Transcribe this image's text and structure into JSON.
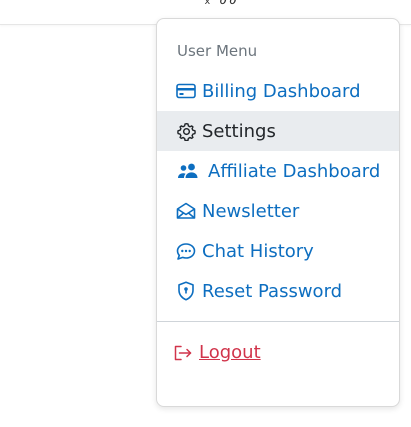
{
  "topbar": {
    "glyph": "ₓ ∂∂"
  },
  "menu": {
    "header": "User Menu",
    "items": [
      {
        "label": "Billing Dashboard",
        "icon": "credit-card-icon"
      },
      {
        "label": "Settings",
        "icon": "gear-icon",
        "active": true
      },
      {
        "label": "Affiliate Dashboard",
        "icon": "people-icon"
      },
      {
        "label": "Newsletter",
        "icon": "envelope-icon"
      },
      {
        "label": "Chat History",
        "icon": "chat-dots-icon"
      },
      {
        "label": "Reset Password",
        "icon": "shield-lock-icon"
      }
    ],
    "logout": {
      "label": "Logout",
      "icon": "logout-icon"
    }
  },
  "colors": {
    "link": "#0d6ec0",
    "active_bg": "#e9ecef",
    "active_text": "#212529",
    "header_text": "#6c757d",
    "logout": "#d1344b"
  }
}
